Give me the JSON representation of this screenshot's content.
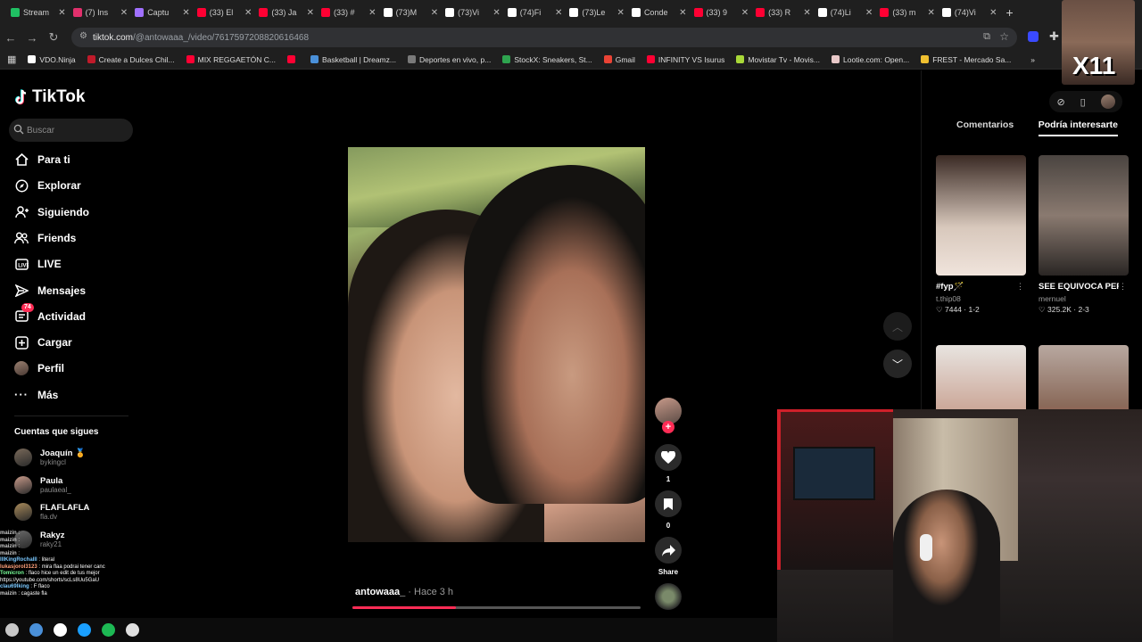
{
  "browser": {
    "tabs": [
      {
        "label": "Stream",
        "icon": "shield-green-icon",
        "color": "#20c063"
      },
      {
        "label": "(7) Ins",
        "icon": "instagram-icon",
        "color": "#e1306c"
      },
      {
        "label": "Captu",
        "icon": "pen-icon",
        "color": "#a070ff"
      },
      {
        "label": "(33) El",
        "icon": "youtube-icon",
        "color": "#ff0033"
      },
      {
        "label": "(33) Ja",
        "icon": "youtube-icon",
        "color": "#ff0033"
      },
      {
        "label": "(33) #",
        "icon": "youtube-icon",
        "color": "#ff0033"
      },
      {
        "label": "(73)M",
        "icon": "tiktok-icon",
        "color": "#ffffff"
      },
      {
        "label": "(73)Vi",
        "icon": "tiktok-icon",
        "color": "#ffffff"
      },
      {
        "label": "(74)Fi",
        "icon": "tiktok-icon",
        "color": "#ffffff"
      },
      {
        "label": "(73)Le",
        "icon": "tiktok-icon",
        "color": "#ffffff"
      },
      {
        "label": "Conde",
        "icon": "tiktok-icon",
        "color": "#ffffff"
      },
      {
        "label": "(33) 9",
        "icon": "youtube-icon",
        "color": "#ff0033"
      },
      {
        "label": "(33) R",
        "icon": "youtube-icon",
        "color": "#ff0033"
      },
      {
        "label": "(74)Li",
        "icon": "tiktok-icon",
        "color": "#ffffff"
      },
      {
        "label": "(33) m",
        "icon": "youtube-icon",
        "color": "#ff0033"
      },
      {
        "label": "(74)Vi",
        "icon": "tiktok-icon",
        "color": "#ffffff"
      }
    ],
    "new_tab": "+",
    "url_host": "tiktok.com",
    "url_path": "/@antowaaa_/video/7617597208820616468",
    "bookmarks": [
      {
        "label": "VDO.Ninja",
        "color": "#ffffff"
      },
      {
        "label": "Create a Dulces Chil...",
        "color": "#c01a2a"
      },
      {
        "label": "MIX REGGAETÓN C...",
        "color": "#ff0033"
      },
      {
        "label": "",
        "color": "#ff0033"
      },
      {
        "label": "Basketball | Dreamz...",
        "color": "#4a90d9"
      },
      {
        "label": "Deportes en vivo, p...",
        "color": "#7a7a7a"
      },
      {
        "label": "StockX: Sneakers, St...",
        "color": "#2ea44f"
      },
      {
        "label": "Gmail",
        "color": "#ea4335"
      },
      {
        "label": "INFINITY VS Isurus",
        "color": "#ff0033"
      },
      {
        "label": "Movistar Tv - Movis...",
        "color": "#a8d838"
      },
      {
        "label": "Lootie.com: Open...",
        "color": "#e8c8c8"
      },
      {
        "label": "FREST - Mercado Sa...",
        "color": "#f0c030"
      }
    ],
    "more_bookmarks": "»"
  },
  "sidebar": {
    "logo": "TikTok",
    "search_placeholder": "Buscar",
    "nav": [
      {
        "label": "Para ti",
        "icon": "home-icon"
      },
      {
        "label": "Explorar",
        "icon": "compass-icon"
      },
      {
        "label": "Siguiendo",
        "icon": "following-icon"
      },
      {
        "label": "Friends",
        "icon": "friends-icon"
      },
      {
        "label": "LIVE",
        "icon": "live-icon"
      },
      {
        "label": "Mensajes",
        "icon": "send-icon"
      },
      {
        "label": "Actividad",
        "icon": "activity-icon",
        "badge": "74"
      },
      {
        "label": "Cargar",
        "icon": "upload-icon"
      },
      {
        "label": "Perfil",
        "icon": "profile-avatar"
      },
      {
        "label": "Más",
        "icon": "more-icon"
      }
    ],
    "following_title": "Cuentas que sigues",
    "following": [
      {
        "name": "Joaquín 🏅",
        "handle": "bykingcl",
        "color": "#7a6a5a"
      },
      {
        "name": "Paula",
        "handle": "paulaeal_",
        "color": "#c89a8a"
      },
      {
        "name": "FLAFLAFLA",
        "handle": "fla.dv",
        "color": "#a88a5a"
      },
      {
        "name": "Rakyz",
        "handle": "raky21",
        "color": "#6a6a6a"
      }
    ]
  },
  "chat": [
    {
      "user": "maizin",
      "text": ":",
      "color": "#c8c8c8"
    },
    {
      "user": "maizin",
      "text": ":",
      "color": "#c8c8c8"
    },
    {
      "user": "maizin",
      "text": ":",
      "color": "#c8c8c8"
    },
    {
      "user": "maizin",
      "text": ":",
      "color": "#c8c8c8"
    },
    {
      "user": "IlIKingRochalIl",
      "text": ": literal",
      "color": "#7ac8ff"
    },
    {
      "user": "lukasjorol3123",
      "text": ": mira flaa podrai tener canc",
      "color": "#ffa07a"
    },
    {
      "user": "Tomicron",
      "text": ": flaco hice un edit de tus mejor",
      "color": "#7aff9a"
    },
    {
      "user": "",
      "text": "https://youtube.com/shorts/scLs8Uu5GaU",
      "color": "#ffffff"
    },
    {
      "user": "clau69lking",
      "text": ": F flaco",
      "color": "#7ac8ff"
    },
    {
      "user": "maizin",
      "text": ": cagaste fla",
      "color": "#c8c8c8"
    }
  ],
  "video": {
    "author": "antowaaa_",
    "time": " · Hace 3 h",
    "progress": 0.36,
    "likes": "1",
    "saves": "0",
    "share_label": "Share"
  },
  "right": {
    "tab_comments": "Comentarios",
    "tab_suggested": "Podría interesarte",
    "cards": [
      {
        "title": "#fyp🪄",
        "author": "t.thip08",
        "likes": "7444",
        "ep": "1-2",
        "grad": "linear-gradient(180deg,#3a2a24,#d8c8bc 60%,#f0e4dc)"
      },
      {
        "title": "SEE EQUIVOCA PEPU #mernuel...",
        "author": "mernuel",
        "likes": "325.2K",
        "ep": "2-3",
        "grad": "linear-gradient(180deg,#4a4440,#8a7a70 50%,#2a2624)"
      },
      {
        "title": "",
        "author": "",
        "likes": "",
        "ep": "",
        "grad": "linear-gradient(180deg,#e8e4e0,#c8a090 60%,#6a4a40)"
      },
      {
        "title": "",
        "author": "",
        "likes": "",
        "ep": "",
        "grad": "linear-gradient(180deg,#b8a8a0,#8a6a5a 50%,#c83a2a)"
      }
    ]
  },
  "overlay_text": "X11",
  "taskbar": [
    {
      "icon": "start-icon",
      "color": "#c8c8c8"
    },
    {
      "icon": "chrome-icon",
      "color": "#4a90d9"
    },
    {
      "icon": "obs-icon",
      "color": "#ffffff"
    },
    {
      "icon": "steam-icon",
      "color": "#1a9fff"
    },
    {
      "icon": "spotify-icon",
      "color": "#1db954"
    },
    {
      "icon": "record-icon",
      "color": "#e0e0e0"
    }
  ]
}
